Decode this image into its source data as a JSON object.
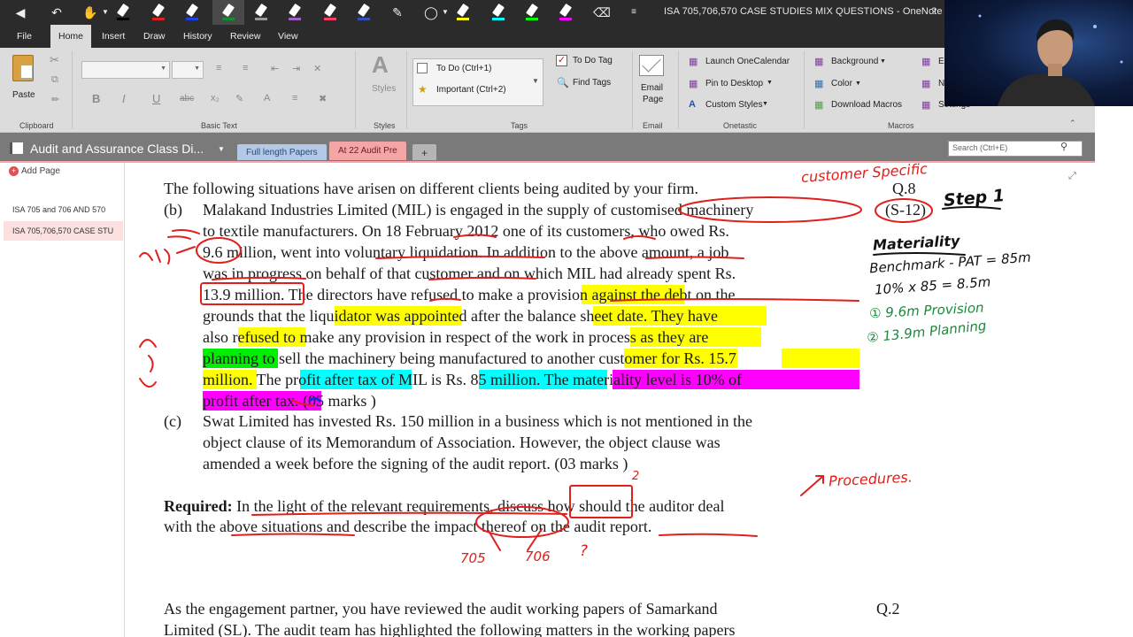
{
  "window": {
    "title": "ISA 705,706,570 CASE STUDIES MIX QUESTIONS - OneNote",
    "help": "?"
  },
  "menu_tabs": [
    "File",
    "Home",
    "Insert",
    "Draw",
    "History",
    "Review",
    "View"
  ],
  "active_tab": "Home",
  "ribbon": {
    "clipboard": {
      "paste": "Paste",
      "label": "Clipboard"
    },
    "basic_text": {
      "label": "Basic Text",
      "bold": "B",
      "italic": "I",
      "underline": "U",
      "strike": "abc"
    },
    "styles": {
      "button": "Styles",
      "label": "Styles"
    },
    "tags": {
      "todo": "To Do (Ctrl+1)",
      "important": "Important (Ctrl+2)",
      "todo_tag": "To Do Tag",
      "find_tags": "Find Tags",
      "label": "Tags"
    },
    "email": {
      "button_line1": "Email",
      "button_line2": "Page",
      "label": "Email"
    },
    "onetastic": {
      "launch": "Launch OneCalendar",
      "pin": "Pin to Desktop",
      "custom_styles": "Custom Styles",
      "label": "Onetastic"
    },
    "macros": {
      "background": "Background",
      "color": "Color",
      "download": "Download Macros",
      "e": "Ei",
      "n": "N",
      "settings": "Settings",
      "label": "Macros"
    }
  },
  "notebook": {
    "title": "Audit and Assurance Class Di...",
    "sections": [
      "Full length Papers",
      "At 22 Audit Pre"
    ],
    "add_section": "+",
    "search_placeholder": "Search (Ctrl+E)"
  },
  "pages": {
    "add_page": "Add Page",
    "items": [
      "ISA 705 and 706 AND 570",
      "ISA 705,706,570 CASE STU"
    ]
  },
  "content": {
    "intro": "The following situations have arisen on different clients being audited by your firm.",
    "qnum": "Q.8",
    "qref": "(S-12)",
    "b_label": "(b)",
    "b_lines": [
      "Malakand Industries Limited (MIL) is engaged in the supply of customised machinery",
      "to textile manufacturers. On 18 February 2012 one of its customers, who owed Rs.",
      "9.6 million, went into voluntary liquidation. In addition to the above amount, a job",
      "was in progress on behalf of that customer and on which MIL had already spent Rs.",
      "13.9 million. The directors have refused to make a provision against the debt on the",
      "grounds that the liquidator was appointed after the balance sheet date. They have",
      "also refused to make any provision in respect of the work in process as they are",
      "planning to sell the machinery being manufactured to another customer for Rs. 15.7",
      "million. The profit after tax of MIL is Rs. 85 million. The materiality level is 10% of",
      "profit after tax. (05 marks )"
    ],
    "c_label": "(c)",
    "c_lines": [
      "Swat Limited has invested Rs. 150 million in a business which is not mentioned in the",
      "object clause of its Memorandum of Association. However, the object clause was",
      "amended a week before the signing of the audit report. (03 marks )"
    ],
    "required_bold": "Required:",
    "required_rest": " In the light of the relevant requirements, discuss how should the auditor deal",
    "required_line2": "with the above situations and describe the impact thereof on the audit report.",
    "next_q": "As the engagement partner, you have reviewed the audit working papers of Samarkand",
    "next_qnum": "Q.2",
    "next_line2": "Limited (SL). The audit team has highlighted the following matters in the working papers"
  },
  "annotations": {
    "customer_specific": "customer Specific",
    "step": "Step 1",
    "materiality": "Materiality",
    "benchmark": "Benchmark - PAT = 85m",
    "calc": "10% x 85 = 8.5m",
    "provision": "① 9.6m Provision",
    "planning": "② 13.9m Planning",
    "procedures": "Procedures.",
    "two": "2",
    "n705": "705",
    "n706": "706",
    "q": "?"
  },
  "colors": {
    "yellow": "#ffff00",
    "green": "#00ee00",
    "cyan": "#00ffff",
    "magenta": "#ff00ff",
    "ink_red": "#e0201c",
    "ink_green": "#1a8a3a",
    "accent_tab": "#f4a6a6"
  }
}
